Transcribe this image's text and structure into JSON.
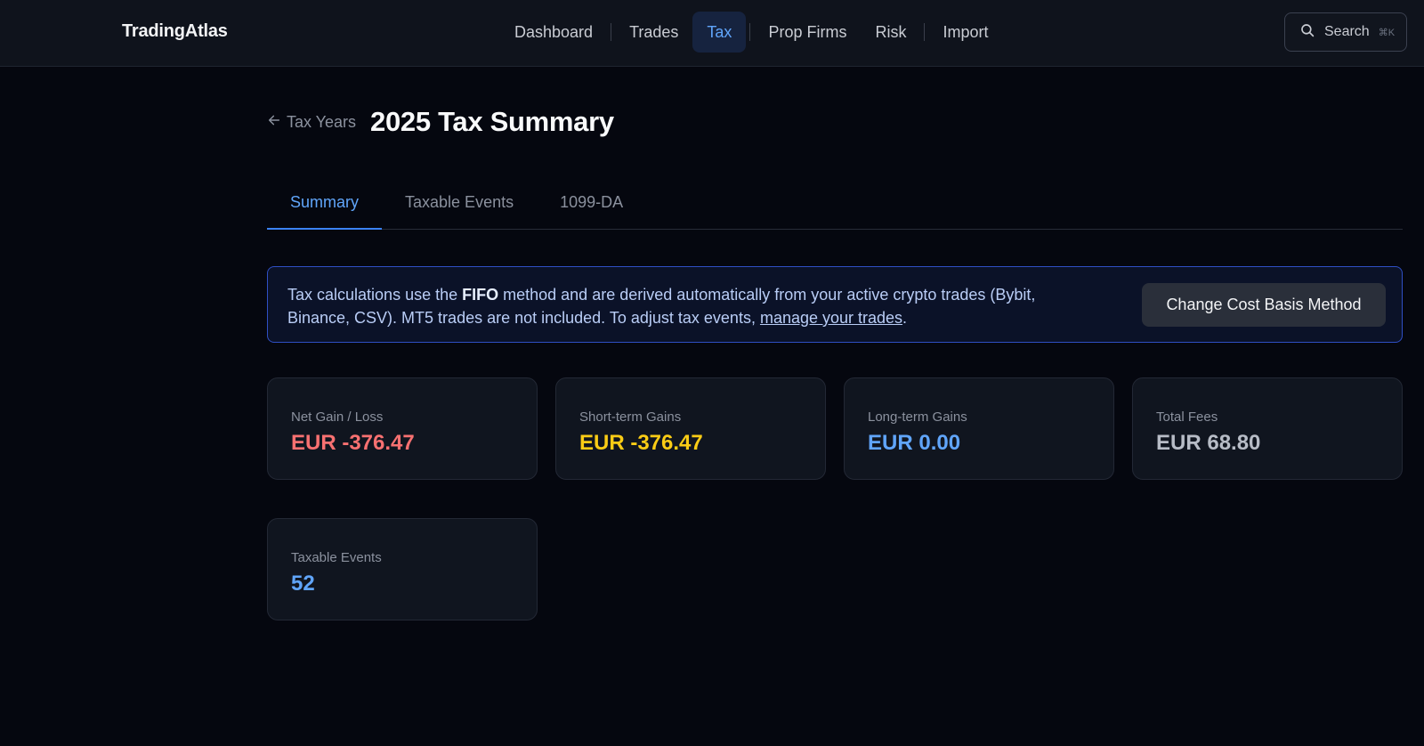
{
  "app": {
    "brand": "TradingAtlas"
  },
  "nav": {
    "items": [
      {
        "label": "Dashboard",
        "active": false
      },
      {
        "label": "Trades",
        "active": false
      },
      {
        "label": "Tax",
        "active": true
      },
      {
        "label": "Prop Firms",
        "active": false
      },
      {
        "label": "Risk",
        "active": false
      },
      {
        "label": "Import",
        "active": false
      }
    ],
    "search_label": "Search",
    "search_shortcut": "⌘K",
    "search_icon": "search-icon"
  },
  "header": {
    "back_label": "Tax Years",
    "back_icon": "arrow-left-icon",
    "title": "2025 Tax Summary"
  },
  "tabs": [
    {
      "label": "Summary",
      "active": true
    },
    {
      "label": "Taxable Events",
      "active": false
    },
    {
      "label": "1099-DA",
      "active": false
    }
  ],
  "banner": {
    "text_before": "Tax calculations use the ",
    "method": "FIFO",
    "text_middle": " method and are derived automatically from your active crypto trades (Bybit, Binance, CSV). MT5 trades are not included. To adjust tax events, ",
    "link_text": "manage your trades",
    "text_after": ".",
    "button_label": "Change Cost Basis Method"
  },
  "stats": [
    {
      "label": "Net Gain / Loss",
      "value": "EUR -376.47",
      "color": "#f87171"
    },
    {
      "label": "Short-term Gains",
      "value": "EUR -376.47",
      "color": "#facc15"
    },
    {
      "label": "Long-term Gains",
      "value": "EUR 0.00",
      "color": "#60a5fa"
    },
    {
      "label": "Total Fees",
      "value": "EUR 68.80",
      "color": "#b7bcc6"
    },
    {
      "label": "Taxable Events",
      "value": "52",
      "color": "#60a5fa"
    }
  ]
}
